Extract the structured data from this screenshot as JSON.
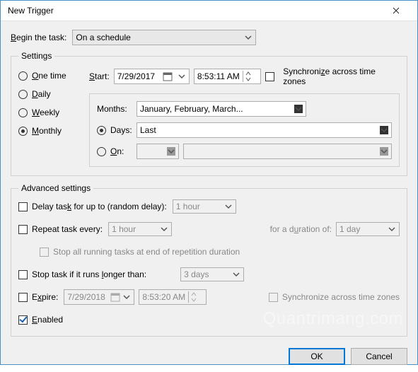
{
  "window": {
    "title": "New Trigger"
  },
  "begin": {
    "label": "Begin the task:",
    "value": "On a schedule"
  },
  "settings": {
    "legend": "Settings",
    "freq": {
      "one_time_u": "O",
      "one_time_rest": "ne time",
      "daily_u": "D",
      "daily_rest": "aily",
      "weekly_u": "W",
      "weekly_rest": "eekly",
      "monthly_u": "M",
      "monthly_rest": "onthly"
    },
    "start": {
      "label_u": "S",
      "label_rest": "tart:",
      "date": "7/29/2017",
      "time": "8:53:11 AM",
      "sync_label": "Synchroni",
      "sync_u": "z",
      "sync_rest": "e across time zones"
    },
    "monthly": {
      "months_label": "Months:",
      "months_value": "January, February, March...",
      "days_label": "Days:",
      "days_value": "Last",
      "on_label_u": "O",
      "on_label_rest": "n:"
    }
  },
  "advanced": {
    "legend": "Advanced settings",
    "delay_label": "Delay task for up to (random delay):",
    "delay_value": "1 hour",
    "repeat_label": "Repeat task every:",
    "repeat_value": "1 hour",
    "duration_label": "for a duration of:",
    "duration_value": "1 day",
    "stop_all_label": "Stop all running tasks at end of repetition duration",
    "stop_if_label": "Stop task if it runs longer than:",
    "stop_if_u": "l",
    "stop_if_value": "3 days",
    "expire_label_u": "x",
    "expire_label_pre": "E",
    "expire_label_post": "pire:",
    "expire_date": "7/29/2018",
    "expire_time": "8:53:20 AM",
    "sync2_label": "Synchronize across time zones",
    "enabled_label_u": "E",
    "enabled_label_rest": "nabled"
  },
  "buttons": {
    "ok": "OK",
    "cancel": "Cancel"
  },
  "watermark": "Quantrimang.com"
}
